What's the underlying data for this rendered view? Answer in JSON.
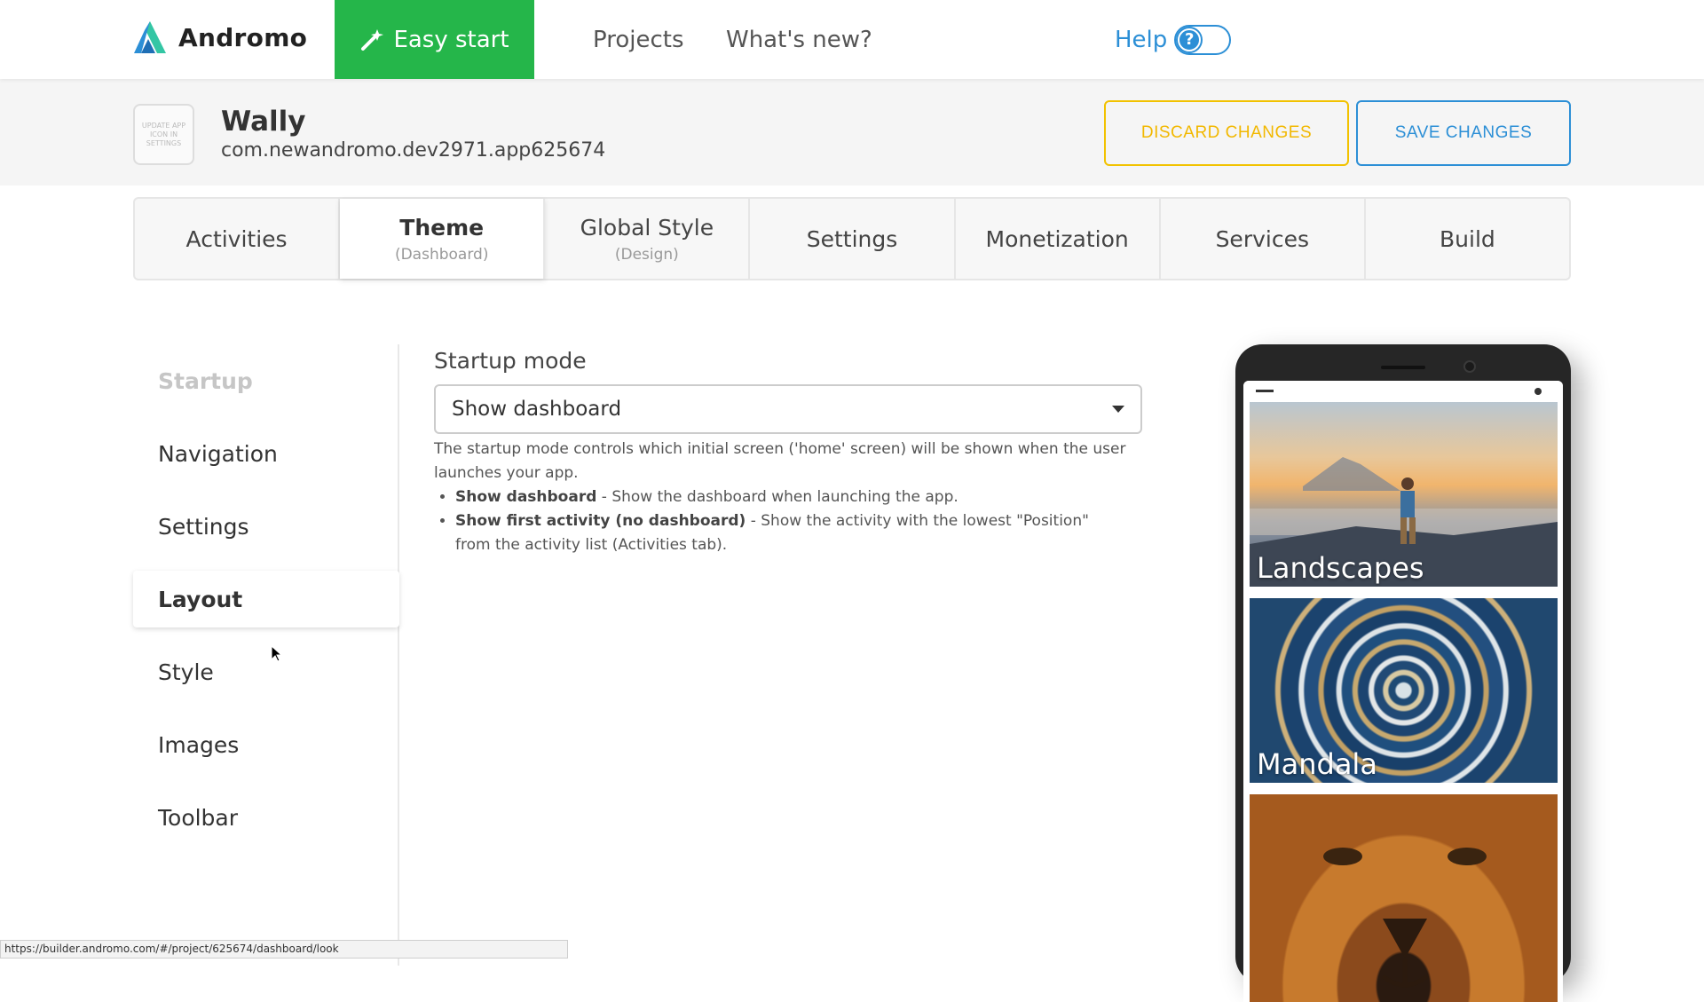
{
  "brand": {
    "name": "Andromo"
  },
  "topnav": {
    "easy_start": "Easy start",
    "projects": "Projects",
    "whats_new": "What's new?",
    "help": "Help",
    "help_icon": "?"
  },
  "project": {
    "icon_placeholder": "UPDATE APP ICON IN SETTINGS",
    "name": "Wally",
    "package": "com.newandromo.dev2971.app625674",
    "discard_label": "DISCARD CHANGES",
    "save_label": "SAVE CHANGES"
  },
  "tabs": [
    {
      "label": "Activities",
      "sub": ""
    },
    {
      "label": "Theme",
      "sub": "(Dashboard)"
    },
    {
      "label": "Global Style",
      "sub": "(Design)"
    },
    {
      "label": "Settings",
      "sub": ""
    },
    {
      "label": "Monetization",
      "sub": ""
    },
    {
      "label": "Services",
      "sub": ""
    },
    {
      "label": "Build",
      "sub": ""
    }
  ],
  "sidebar": {
    "items": [
      {
        "label": "Startup"
      },
      {
        "label": "Navigation"
      },
      {
        "label": "Settings"
      },
      {
        "label": "Layout"
      },
      {
        "label": "Style"
      },
      {
        "label": "Images"
      },
      {
        "label": "Toolbar"
      }
    ]
  },
  "form": {
    "label": "Startup mode",
    "selected": "Show dashboard",
    "help_intro": "The startup mode controls which initial screen ('home' screen) will be shown when the user launches your app.",
    "bullets": [
      {
        "term": "Show dashboard",
        "text": " - Show the dashboard when launching the app."
      },
      {
        "term": "Show first activity (no dashboard)",
        "text": " - Show the activity with the lowest \"Position\" from the activity list (Activities tab)."
      }
    ]
  },
  "preview": {
    "tiles": [
      {
        "label": "Landscapes"
      },
      {
        "label": "Mandala"
      },
      {
        "label": ""
      }
    ]
  },
  "status_url": "https://builder.andromo.com/#/project/625674/dashboard/look",
  "colors": {
    "accent_green": "#25b64a",
    "accent_blue": "#2c8fd6",
    "discard_yellow": "#f2c200"
  }
}
